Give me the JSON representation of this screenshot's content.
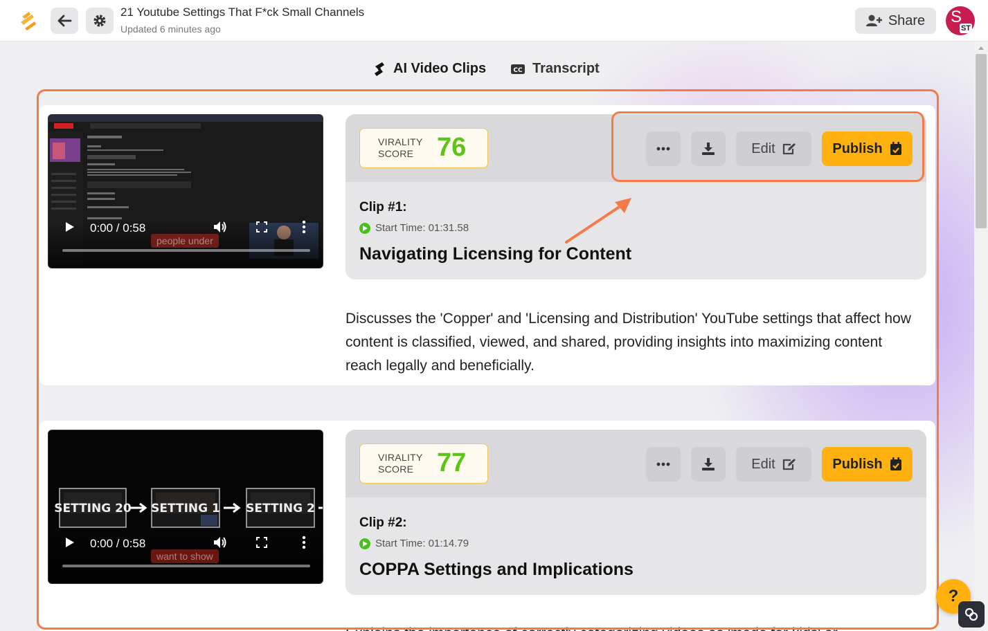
{
  "header": {
    "doc_title": "21 Youtube Settings That F*ck Small Channels",
    "updated": "Updated 6 minutes ago",
    "share_label": "Share",
    "avatar_initials": "ST",
    "avatar_letter": "S"
  },
  "tabs": [
    {
      "label": "AI Video Clips",
      "icon": "scissors-icon",
      "active": true
    },
    {
      "label": "Transcript",
      "icon": "cc-icon",
      "active": false
    }
  ],
  "clips": [
    {
      "virality_label_1": "VIRALITY",
      "virality_label_2": "SCORE",
      "score": "76",
      "edit_label": "Edit",
      "publish_label": "Publish",
      "clip_number": "Clip #1:",
      "start_time": "Start Time: 01:31.58",
      "title": "Navigating Licensing for Content",
      "description": "Discusses the 'Copper' and 'Licensing and Distribution' YouTube settings that affect how content is classified, viewed, and shared, providing insights into maximizing content reach legally and beneficially.",
      "video_time": "0:00 / 0:58",
      "caption": "people under"
    },
    {
      "virality_label_1": "VIRALITY",
      "virality_label_2": "SCORE",
      "score": "77",
      "edit_label": "Edit",
      "publish_label": "Publish",
      "clip_number": "Clip #2:",
      "start_time": "Start Time: 01:14.79",
      "title": "COPPA Settings and Implications",
      "description": "Explains the importance of correctly categorizing videos as 'made for kids' or",
      "video_time": "0:00 / 0:58",
      "caption": "want to show",
      "thumb_labels": [
        "SETTING 20",
        "SETTING 1",
        "SETTING 2"
      ]
    }
  ],
  "help_label": "?",
  "colors": {
    "accent_orange": "#ffb20f",
    "annotation": "#f47a4a",
    "score_green": "#5cc516",
    "avatar": "#c81d50"
  }
}
